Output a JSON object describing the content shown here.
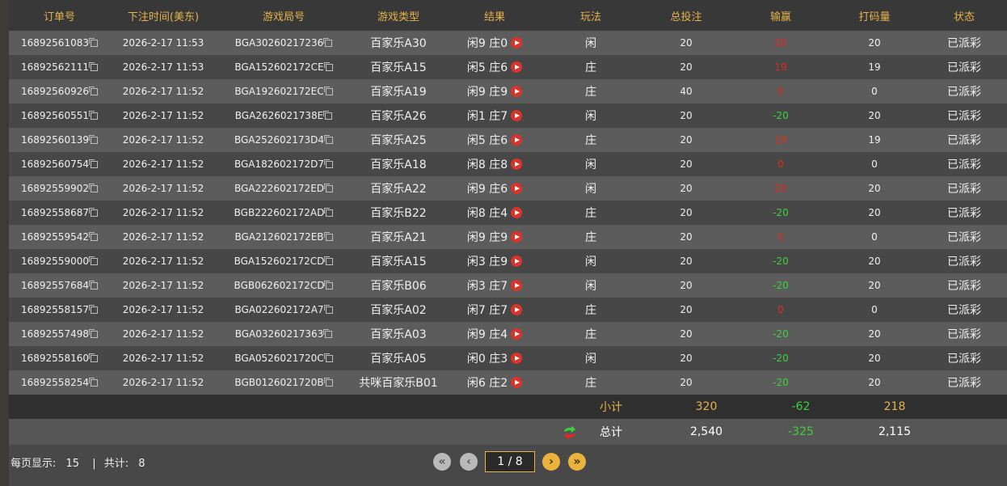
{
  "columns": [
    "订单号",
    "下注时间(美东)",
    "游戏局号",
    "游戏类型",
    "结果",
    "玩法",
    "总投注",
    "输赢",
    "打码量",
    "状态"
  ],
  "rows": [
    {
      "order": "16892561083",
      "time": "2026-2-17 11:53",
      "round": "BGA30260217236",
      "game": "百家乐A30",
      "result": "闲9 庄0",
      "play": "闲",
      "bet": "20",
      "win": "20",
      "win_color": "red",
      "code": "20",
      "status": "已派彩"
    },
    {
      "order": "16892562111",
      "time": "2026-2-17 11:53",
      "round": "BGA152602172CE",
      "game": "百家乐A15",
      "result": "闲5 庄6",
      "play": "庄",
      "bet": "20",
      "win": "19",
      "win_color": "red",
      "code": "19",
      "status": "已派彩"
    },
    {
      "order": "16892560926",
      "time": "2026-2-17 11:52",
      "round": "BGA192602172EC",
      "game": "百家乐A19",
      "result": "闲9 庄9",
      "play": "庄",
      "bet": "40",
      "win": "0",
      "win_color": "red",
      "code": "0",
      "status": "已派彩"
    },
    {
      "order": "16892560551",
      "time": "2026-2-17 11:52",
      "round": "BGA2626021738E",
      "game": "百家乐A26",
      "result": "闲1 庄7",
      "play": "闲",
      "bet": "20",
      "win": "-20",
      "win_color": "green",
      "code": "20",
      "status": "已派彩"
    },
    {
      "order": "16892560139",
      "time": "2026-2-17 11:52",
      "round": "BGA252602173D4",
      "game": "百家乐A25",
      "result": "闲5 庄6",
      "play": "庄",
      "bet": "20",
      "win": "19",
      "win_color": "red",
      "code": "19",
      "status": "已派彩"
    },
    {
      "order": "16892560754",
      "time": "2026-2-17 11:52",
      "round": "BGA182602172D7",
      "game": "百家乐A18",
      "result": "闲8 庄8",
      "play": "闲",
      "bet": "20",
      "win": "0",
      "win_color": "red",
      "code": "0",
      "status": "已派彩"
    },
    {
      "order": "16892559902",
      "time": "2026-2-17 11:52",
      "round": "BGA222602172ED",
      "game": "百家乐A22",
      "result": "闲9 庄6",
      "play": "闲",
      "bet": "20",
      "win": "20",
      "win_color": "red",
      "code": "20",
      "status": "已派彩"
    },
    {
      "order": "16892558687",
      "time": "2026-2-17 11:52",
      "round": "BGB222602172AD",
      "game": "百家乐B22",
      "result": "闲8 庄4",
      "play": "庄",
      "bet": "20",
      "win": "-20",
      "win_color": "green",
      "code": "20",
      "status": "已派彩"
    },
    {
      "order": "16892559542",
      "time": "2026-2-17 11:52",
      "round": "BGA212602172EB",
      "game": "百家乐A21",
      "result": "闲9 庄9",
      "play": "庄",
      "bet": "20",
      "win": "0",
      "win_color": "red",
      "code": "0",
      "status": "已派彩"
    },
    {
      "order": "16892559000",
      "time": "2026-2-17 11:52",
      "round": "BGA152602172CD",
      "game": "百家乐A15",
      "result": "闲3 庄9",
      "play": "闲",
      "bet": "20",
      "win": "-20",
      "win_color": "green",
      "code": "20",
      "status": "已派彩"
    },
    {
      "order": "16892557684",
      "time": "2026-2-17 11:52",
      "round": "BGB062602172CD",
      "game": "百家乐B06",
      "result": "闲3 庄7",
      "play": "闲",
      "bet": "20",
      "win": "-20",
      "win_color": "green",
      "code": "20",
      "status": "已派彩"
    },
    {
      "order": "16892558157",
      "time": "2026-2-17 11:52",
      "round": "BGA022602172A7",
      "game": "百家乐A02",
      "result": "闲7 庄7",
      "play": "庄",
      "bet": "20",
      "win": "0",
      "win_color": "red",
      "code": "0",
      "status": "已派彩"
    },
    {
      "order": "16892557498",
      "time": "2026-2-17 11:52",
      "round": "BGA03260217363",
      "game": "百家乐A03",
      "result": "闲9 庄4",
      "play": "庄",
      "bet": "20",
      "win": "-20",
      "win_color": "green",
      "code": "20",
      "status": "已派彩"
    },
    {
      "order": "16892558160",
      "time": "2026-2-17 11:52",
      "round": "BGA0526021720C",
      "game": "百家乐A05",
      "result": "闲0 庄3",
      "play": "闲",
      "bet": "20",
      "win": "-20",
      "win_color": "green",
      "code": "20",
      "status": "已派彩"
    },
    {
      "order": "16892558254",
      "time": "2026-2-17 11:52",
      "round": "BGB0126021720B",
      "game": "共咪百家乐B01",
      "result": "闲6 庄2",
      "play": "庄",
      "bet": "20",
      "win": "-20",
      "win_color": "green",
      "code": "20",
      "status": "已派彩"
    }
  ],
  "subtotal": {
    "label": "小计",
    "bet": "320",
    "win": "-62",
    "code": "218"
  },
  "total": {
    "label": "总计",
    "bet": "2,540",
    "win": "-325",
    "code": "2,115"
  },
  "footer": {
    "per_page_label": "每页显示:",
    "per_page": "15",
    "sep": "|",
    "count_label": "共计:",
    "count": "8"
  },
  "pager": {
    "page": "1 / 8"
  },
  "colors": {
    "header_gold": "#e6b34a",
    "win_red": "#e02a1e",
    "loss_green": "#3ad23a",
    "subtotal_gold": "#e6b34a"
  }
}
